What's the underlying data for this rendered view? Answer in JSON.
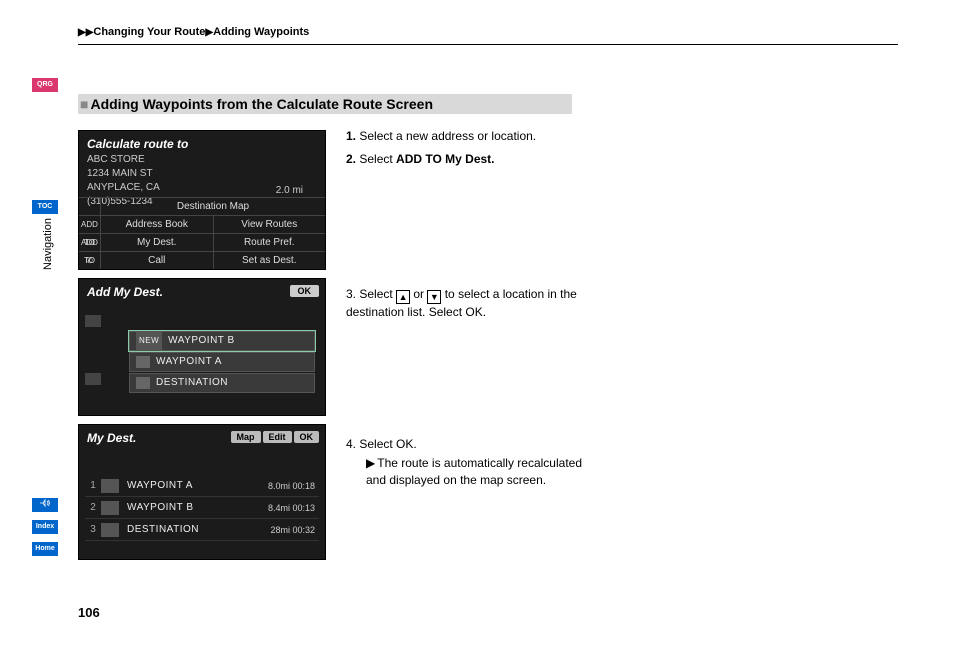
{
  "breadcrumb": {
    "item1": "Changing Your Route",
    "item2": "Adding Waypoints"
  },
  "sidebar": {
    "qrg": "QRG",
    "toc": "TOC",
    "vtext": "Navigation",
    "voice": "",
    "index": "Index",
    "home": "Home"
  },
  "heading": "Adding Waypoints from the Calculate Route Screen",
  "shot1": {
    "title": "Calculate route to",
    "line1": "ABC STORE",
    "line2": "1234 MAIN ST",
    "line3": "ANYPLACE, CA",
    "line4": "(310)555-1234",
    "distance": "2.0 mi",
    "btn_destmap": "Destination Map",
    "r1c1": "Address Book",
    "r1c2": "View Routes",
    "r2c1": "My Dest.",
    "r2c2": "Route Pref.",
    "r3c1": "Call",
    "r3c2": "Set as Dest."
  },
  "shot2": {
    "title": "Add My Dest.",
    "ok": "OK",
    "new": "NEW",
    "wb": "WAYPOINT B",
    "wa": "WAYPOINT A",
    "dest": "DESTINATION"
  },
  "shot3": {
    "title": "My Dest.",
    "map": "Map",
    "edit": "Edit",
    "ok": "OK",
    "r1name": "WAYPOINT A",
    "r1d": "8.0mi 00:18",
    "r2name": "WAYPOINT B",
    "r2d": "8.4mi 00:13",
    "r3name": "DESTINATION",
    "r3d": "28mi 00:32"
  },
  "steps": {
    "s1": "Select a new address or location.",
    "s2a": "Select ",
    "s2b": "ADD TO My Dest.",
    "s3a": "Select ",
    "s3b": " or ",
    "s3c": " to select a location in the destination list. Select ",
    "s3d": "OK",
    "s3e": ".",
    "s4a": "Select ",
    "s4b": "OK",
    "s4c": ".",
    "s4sub": "The route is automatically recalculated and displayed on the map screen."
  },
  "page": "106"
}
